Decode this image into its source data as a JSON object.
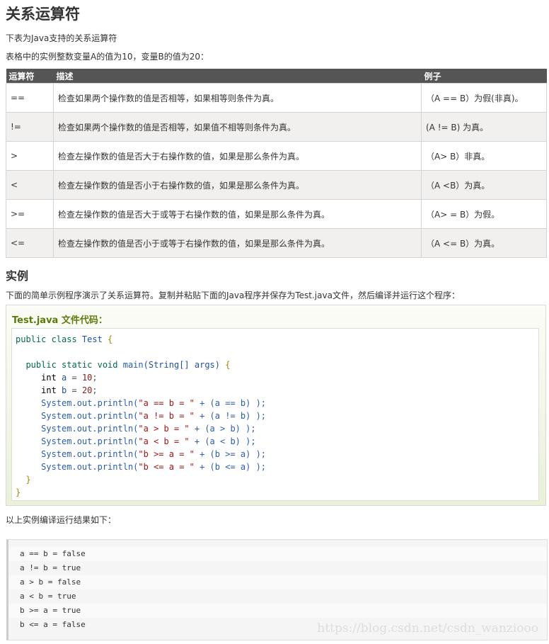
{
  "title": "关系运算符",
  "intro1": "下表为Java支持的关系运算符",
  "intro2": "表格中的实例整数变量A的值为10，变量B的值为20：",
  "table": {
    "headers": [
      "运算符",
      "描述",
      "例子"
    ],
    "rows": [
      [
        "==",
        "检查如果两个操作数的值是否相等，如果相等则条件为真。",
        "（A == B）为假(非真)。"
      ],
      [
        "!=",
        "检查如果两个操作数的值是否相等，如果值不相等则条件为真。",
        "(A != B) 为真。"
      ],
      [
        ">",
        "检查左操作数的值是否大于右操作数的值，如果是那么条件为真。",
        "（A> B）非真。"
      ],
      [
        "<",
        "检查左操作数的值是否小于右操作数的值，如果是那么条件为真。",
        "（A <B）为真。"
      ],
      [
        ">=",
        "检查左操作数的值是否大于或等于右操作数的值，如果是那么条件为真。",
        "（A> = B）为假。"
      ],
      [
        "<=",
        "检查左操作数的值是否小于或等于右操作数的值，如果是那么条件为真。",
        "（A <= B）为真。"
      ]
    ]
  },
  "example_heading": "实例",
  "example_desc": "下面的简单示例程序演示了关系运算符。复制并粘贴下面的Java程序并保存为Test.java文件，然后编译并运行这个程序：",
  "code_title": "Test.java 文件代码：",
  "code": [
    [
      [
        "public class ",
        "kw"
      ],
      [
        "Test ",
        "ty"
      ],
      [
        "{",
        "br"
      ]
    ],
    [],
    [
      [
        "  public static void ",
        "kw"
      ],
      [
        "main",
        "fn"
      ],
      [
        "(String[] args) ",
        "ty"
      ],
      [
        "{",
        "br"
      ]
    ],
    [
      [
        "     int ",
        "pl"
      ],
      [
        "a ",
        "ty"
      ],
      [
        "= ",
        "op"
      ],
      [
        "10",
        "nm"
      ],
      [
        ";",
        "op"
      ]
    ],
    [
      [
        "     int ",
        "pl"
      ],
      [
        "b ",
        "ty"
      ],
      [
        "= ",
        "op"
      ],
      [
        "20",
        "nm"
      ],
      [
        ";",
        "op"
      ]
    ],
    [
      [
        "     System.out.println(",
        "fn"
      ],
      [
        "\"a == b = \"",
        "st"
      ],
      [
        " + (a == b) );",
        "fn"
      ]
    ],
    [
      [
        "     System.out.println(",
        "fn"
      ],
      [
        "\"a != b = \"",
        "st"
      ],
      [
        " + (a != b) );",
        "fn"
      ]
    ],
    [
      [
        "     System.out.println(",
        "fn"
      ],
      [
        "\"a > b = \"",
        "st"
      ],
      [
        " + (a > b) );",
        "fn"
      ]
    ],
    [
      [
        "     System.out.println(",
        "fn"
      ],
      [
        "\"a < b = \"",
        "st"
      ],
      [
        " + (a < b) );",
        "fn"
      ]
    ],
    [
      [
        "     System.out.println(",
        "fn"
      ],
      [
        "\"b >= a = \"",
        "st"
      ],
      [
        " + (b >= a) );",
        "fn"
      ]
    ],
    [
      [
        "     System.out.println(",
        "fn"
      ],
      [
        "\"b <= a = \"",
        "st"
      ],
      [
        " + (b <= a) );",
        "fn"
      ]
    ],
    [
      [
        "  }",
        "br"
      ]
    ],
    [
      [
        "}",
        "br"
      ]
    ]
  ],
  "result_label": "以上实例编译运行结果如下：",
  "output": [
    "a == b = false",
    "a != b = true",
    "a > b = false",
    "a < b = true",
    "b >= a = true",
    "b <= a = false"
  ],
  "watermark": "https://blog.csdn.net/csdn_wanziooo"
}
